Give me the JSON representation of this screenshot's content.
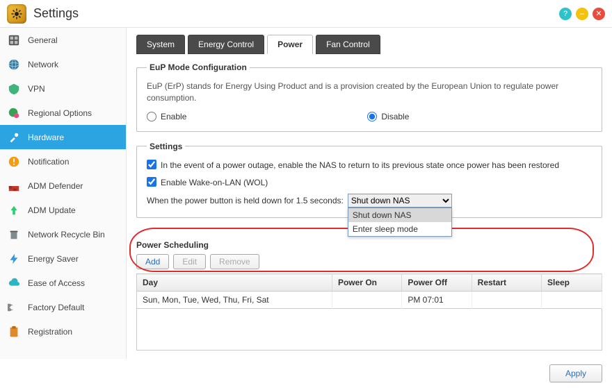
{
  "window": {
    "title": "Settings"
  },
  "sidebar": {
    "items": [
      {
        "label": "General"
      },
      {
        "label": "Network"
      },
      {
        "label": "VPN"
      },
      {
        "label": "Regional Options"
      },
      {
        "label": "Hardware"
      },
      {
        "label": "Notification"
      },
      {
        "label": "ADM Defender"
      },
      {
        "label": "ADM Update"
      },
      {
        "label": "Network Recycle Bin"
      },
      {
        "label": "Energy Saver"
      },
      {
        "label": "Ease of Access"
      },
      {
        "label": "Factory Default"
      },
      {
        "label": "Registration"
      }
    ],
    "active_index": 4
  },
  "tabs": {
    "items": [
      {
        "label": "System"
      },
      {
        "label": "Energy Control"
      },
      {
        "label": "Power"
      },
      {
        "label": "Fan Control"
      }
    ],
    "active_index": 2
  },
  "eup": {
    "legend": "EuP Mode Configuration",
    "desc": "EuP (ErP) stands for Energy Using Product and is a provision created by the European Union to regulate power consumption.",
    "enable_label": "Enable",
    "disable_label": "Disable",
    "value": "disable"
  },
  "settings": {
    "legend": "Settings",
    "chk1_label": "In the event of a power outage, enable the NAS to return to its previous state once power has been restored",
    "chk1_value": true,
    "chk2_label": "Enable Wake-on-LAN (WOL)",
    "chk2_value": true,
    "pbtn_label": "When the power button is held down for 1.5 seconds:",
    "pbtn_value": "Shut down NAS",
    "pbtn_options": [
      "Shut down NAS",
      "Enter sleep mode"
    ]
  },
  "sched": {
    "legend": "Power Scheduling",
    "buttons": {
      "add": "Add",
      "edit": "Edit",
      "remove": "Remove"
    },
    "headers": {
      "day": "Day",
      "on": "Power On",
      "off": "Power Off",
      "restart": "Restart",
      "sleep": "Sleep"
    },
    "rows": [
      {
        "day": "Sun, Mon, Tue, Wed, Thu, Fri, Sat",
        "on": "",
        "off": "PM 07:01",
        "restart": "",
        "sleep": ""
      }
    ]
  },
  "footer": {
    "apply": "Apply"
  }
}
